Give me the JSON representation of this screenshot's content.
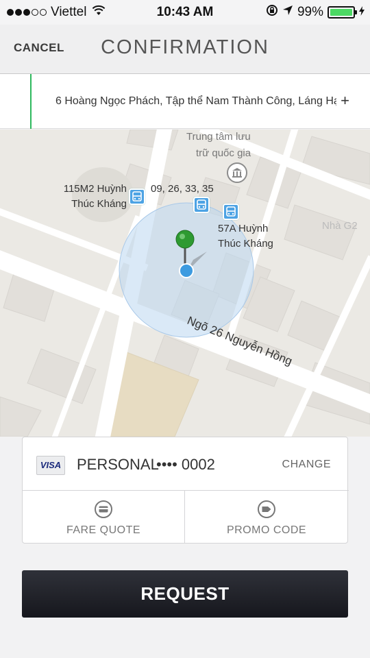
{
  "status_bar": {
    "carrier": "Viettel",
    "time": "10:43 AM",
    "battery_percent": "99%",
    "battery_level": 0.99,
    "signal_bars_filled": 3,
    "signal_bars_total": 5
  },
  "nav": {
    "cancel_label": "CANCEL",
    "title": "CONFIRMATION"
  },
  "pickup": {
    "address": "6 Hoàng Ngọc Phách, Tập thể Nam Thành Công, Láng Hạ",
    "add_label": "+"
  },
  "map": {
    "labels": {
      "archive_line1": "Trung tâm lưu",
      "archive_line2": "trữ quốc gia",
      "bus_stop_115_line1": "115M2 Huỳnh",
      "bus_stop_115_line2": "Thúc Kháng",
      "bus_routes": "09, 26, 33, 35",
      "bus_stop_57_line1": "57A Huỳnh",
      "bus_stop_57_line2": "Thúc Kháng",
      "street_ngo26": "Ngõ 26 Nguyễn Hồng",
      "nha_g": "Nhà G2"
    },
    "colors": {
      "accuracy_circle": "#bcd7f1",
      "pin_green": "#2e9a31",
      "location_dot": "#3d9be0",
      "bus_icon": "#4da3e4"
    }
  },
  "payment": {
    "card_brand": "VISA",
    "profile": "PERSONAL",
    "card_number": "•••• 0002",
    "change_label": "CHANGE",
    "fare_quote_label": "FARE QUOTE",
    "promo_code_label": "PROMO CODE"
  },
  "request_label": "REQUEST",
  "colors": {
    "accent_green": "#2db85c",
    "button_dark": "#1e1f25",
    "battery_green": "#4cd964"
  }
}
